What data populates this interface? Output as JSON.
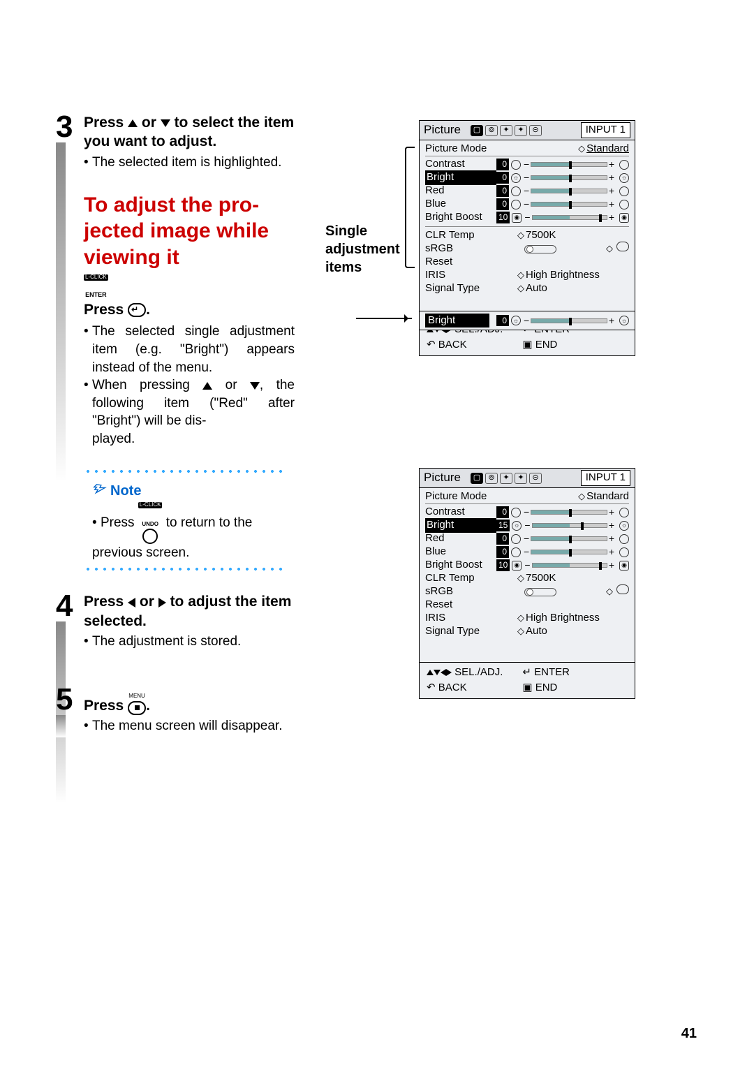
{
  "page_number": "41",
  "steps": {
    "s3": {
      "num": "3",
      "title_a": "Press ",
      "title_b": " or ",
      "title_c": " to select the item you want to adjust.",
      "body1": "The selected item is highlighted."
    },
    "red_heading": "To adjust the pro-\njected image while\nviewing it",
    "enter_small1": "L-CLICK",
    "enter_small2": "ENTER",
    "press_enter": "Press ",
    "s3b": {
      "b1": "The selected single adjustment item (e.g. \"Bright\") appears instead of the menu.",
      "b2a": "When pressing ",
      "b2b": " or ",
      "b2c": ", the following item (\"Red\" after \"Bright\") will be dis-\nplayed."
    },
    "note": {
      "label": "Note",
      "body_a": "Press ",
      "body_b": " to return to the previous screen.",
      "undo_top": "L-CLICK",
      "undo_mid": "UNDO"
    },
    "s4": {
      "num": "4",
      "title_a": "Press ",
      "title_b": " or ",
      "title_c": " to adjust the item selected.",
      "body1": "The adjustment is stored."
    },
    "s5": {
      "num": "5",
      "menu_label": "MENU",
      "title": "Press ",
      "body1": "The menu screen will disappear."
    }
  },
  "right_label": "Single\nadjustment\nitems",
  "osd": {
    "head": {
      "picture": "Picture",
      "input": "INPUT 1"
    },
    "pm_label": "Picture Mode",
    "pm_val": "Standard",
    "rows": {
      "contrast": "Contrast",
      "bright": "Bright",
      "red": "Red",
      "blue": "Blue",
      "bboost": "Bright Boost",
      "clr": "CLR Temp",
      "srgb": "sRGB",
      "reset": "Reset",
      "iris": "IRIS",
      "sig": "Signal Type"
    },
    "vals": {
      "contrast": "0",
      "bright0": "0",
      "bright15": "15",
      "red": "0",
      "blue": "0",
      "bboost": "10",
      "clr": "7500K",
      "iris": "High Brightness",
      "sig": "Auto"
    },
    "foot": {
      "sel": "SEL./ADJ.",
      "enter": "ENTER",
      "back": "BACK",
      "end": "END"
    },
    "bar_label": "Bright",
    "bar_val": "0"
  }
}
